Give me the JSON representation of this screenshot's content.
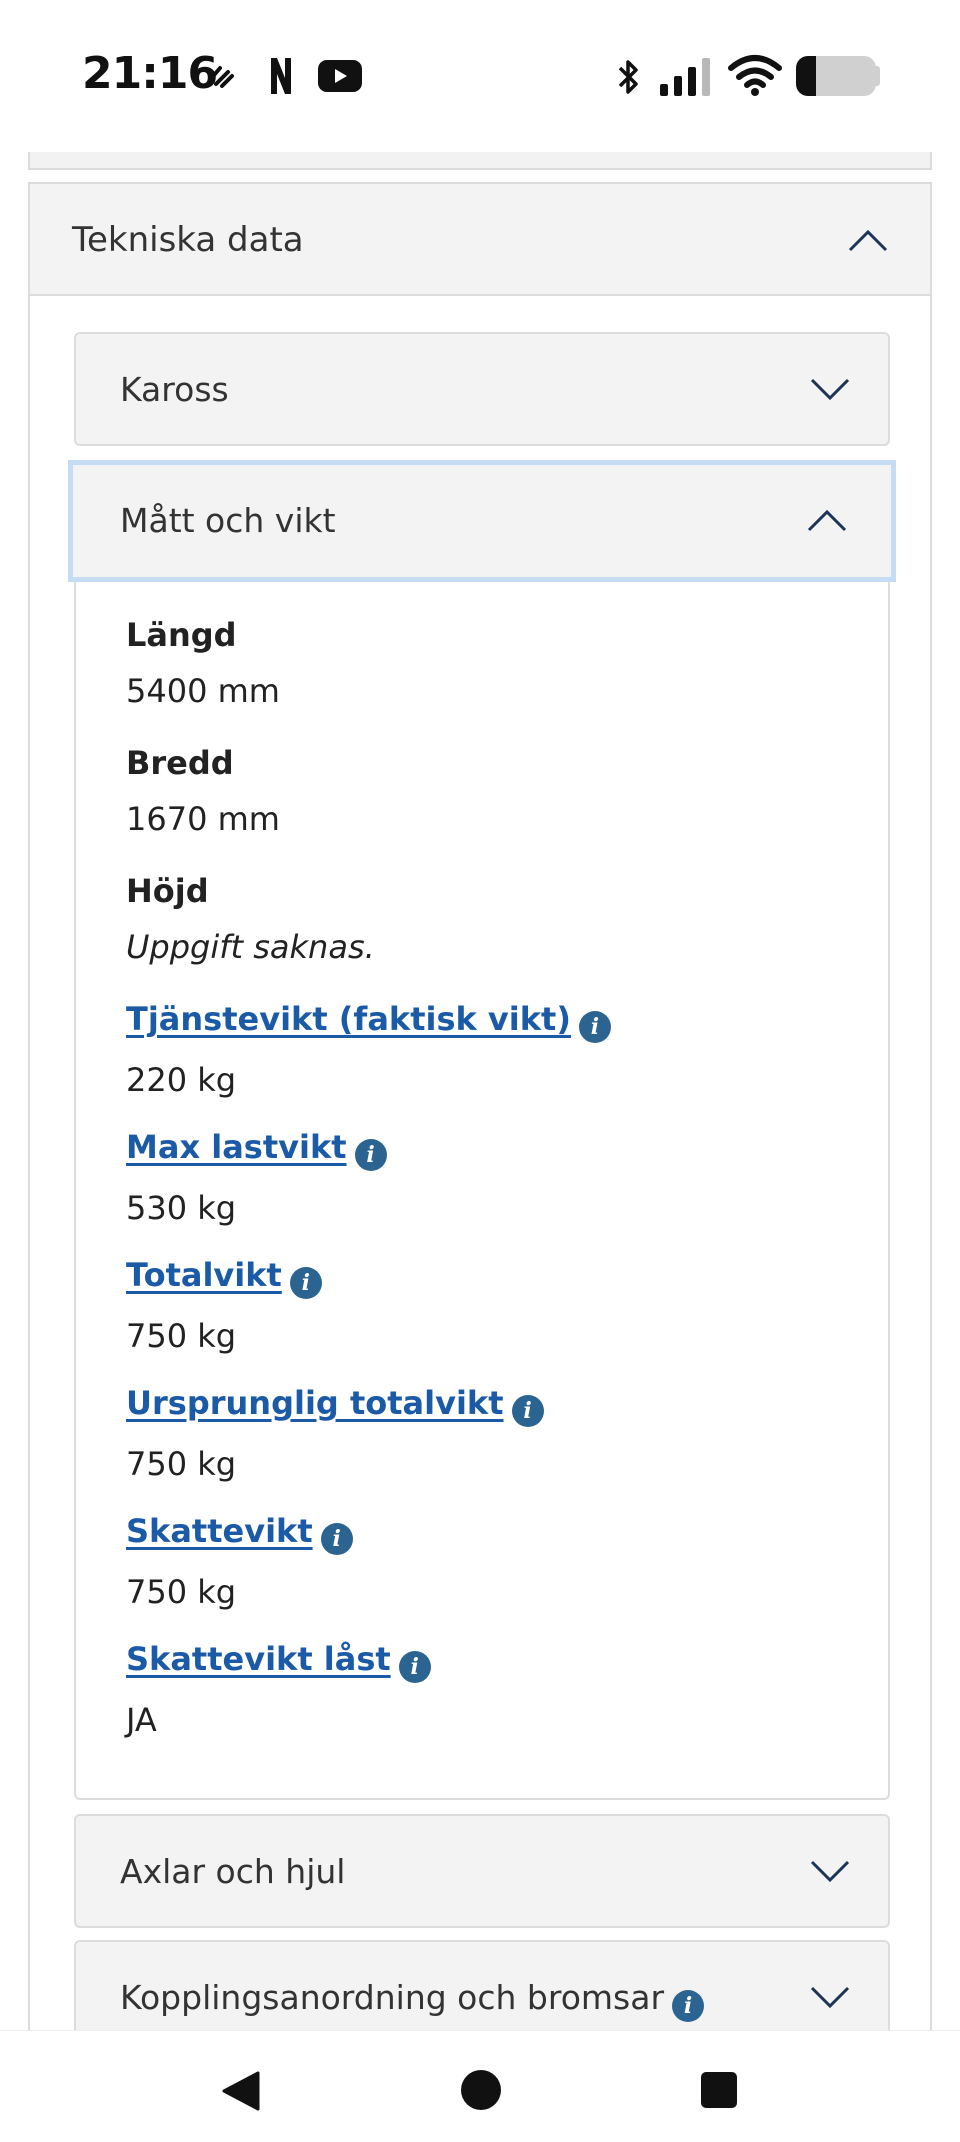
{
  "status_bar": {
    "time": "21:16",
    "notification_icons": [
      "diagonal-lines-icon",
      "n-app-icon",
      "youtube-icon"
    ],
    "system_icons": [
      "bluetooth-icon",
      "signal-icon",
      "wifi-icon",
      "battery-icon"
    ],
    "battery_level": 0.25
  },
  "technical_data": {
    "title": "Tekniska data",
    "expanded": true,
    "sections": [
      {
        "label": "Kaross",
        "expanded": false
      },
      {
        "label": "Mått och vikt",
        "expanded": true
      },
      {
        "label": "Axlar och hjul",
        "expanded": false
      },
      {
        "label": "Kopplingsanordning och bromsar",
        "expanded": false,
        "has_info": true
      }
    ],
    "fields": [
      {
        "label": "Längd",
        "value": "5400 mm",
        "link": false
      },
      {
        "label": "Bredd",
        "value": "1670 mm",
        "link": false
      },
      {
        "label": "Höjd",
        "value": "Uppgift saknas.",
        "link": false,
        "missing": true
      },
      {
        "label": "Tjänstevikt (faktisk vikt)",
        "value": "220 kg",
        "link": true
      },
      {
        "label": "Max lastvikt",
        "value": "530 kg",
        "link": true
      },
      {
        "label": "Totalvikt",
        "value": "750 kg",
        "link": true
      },
      {
        "label": "Ursprunglig totalvikt",
        "value": "750 kg",
        "link": true
      },
      {
        "label": "Skattevikt",
        "value": "750 kg",
        "link": true
      },
      {
        "label": "Skattevikt låst",
        "value": "JA",
        "link": true
      }
    ]
  },
  "info_glyph": "i",
  "colors": {
    "link": "#1a5aa6",
    "info_badge": "#2b6490",
    "panel_bg": "#f3f3f3",
    "focus_ring": "#c6dcf5"
  },
  "nav_bar": {
    "buttons": [
      "back-icon",
      "home-icon",
      "recents-icon"
    ]
  }
}
